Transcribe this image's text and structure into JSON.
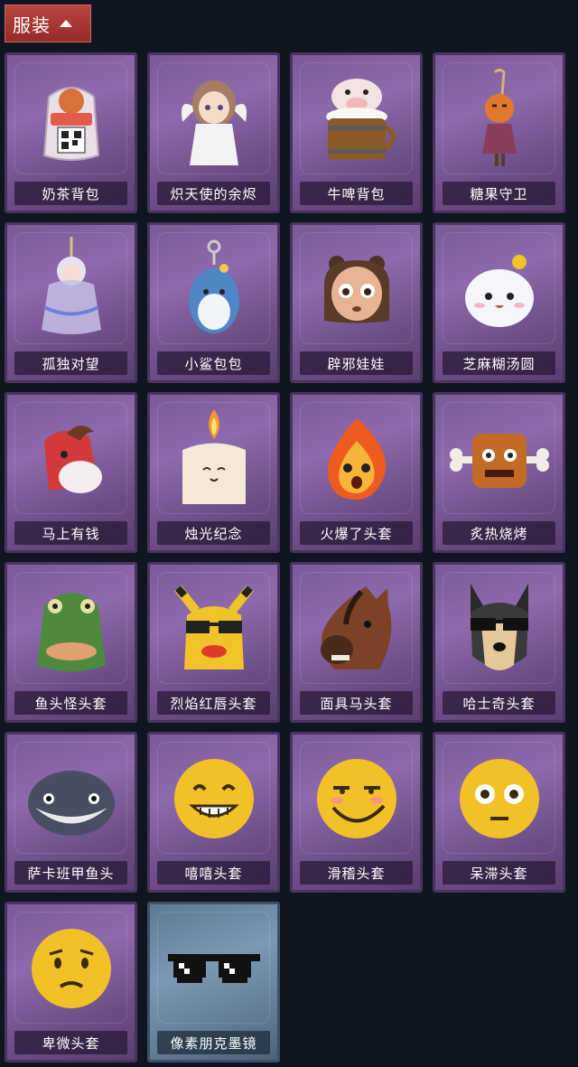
{
  "header": {
    "title": "服装"
  },
  "items": [
    {
      "label": "奶茶背包",
      "icon": "milk-tea-backpack-icon"
    },
    {
      "label": "炽天使的余烬",
      "icon": "angel-doll-icon"
    },
    {
      "label": "牛啤背包",
      "icon": "cow-beer-backpack-icon"
    },
    {
      "label": "糖果守卫",
      "icon": "candy-guard-pendant-icon"
    },
    {
      "label": "孤独对望",
      "icon": "lonely-gaze-pendant-icon"
    },
    {
      "label": "小鲨包包",
      "icon": "shark-bag-icon"
    },
    {
      "label": "辟邪娃娃",
      "icon": "talisman-doll-icon"
    },
    {
      "label": "芝麻糊汤圆",
      "icon": "rice-ball-icon"
    },
    {
      "label": "马上有钱",
      "icon": "red-horse-head-icon"
    },
    {
      "label": "烛光纪念",
      "icon": "candle-icon"
    },
    {
      "label": "火爆了头套",
      "icon": "fire-head-icon"
    },
    {
      "label": "炙热烧烤",
      "icon": "bbq-meat-icon"
    },
    {
      "label": "鱼头怪头套",
      "icon": "fish-head-icon"
    },
    {
      "label": "烈焰红唇头套",
      "icon": "yellow-mask-sunglasses-icon"
    },
    {
      "label": "面具马头套",
      "icon": "horse-mask-icon"
    },
    {
      "label": "哈士奇头套",
      "icon": "husky-sunglasses-icon"
    },
    {
      "label": "萨卡班甲鱼头",
      "icon": "armored-fish-head-icon"
    },
    {
      "label": "嘻嘻头套",
      "icon": "grin-emoji-icon"
    },
    {
      "label": "滑稽头套",
      "icon": "smirk-emoji-icon"
    },
    {
      "label": "呆滞头套",
      "icon": "dazed-emoji-icon"
    },
    {
      "label": "卑微头套",
      "icon": "humble-emoji-icon"
    },
    {
      "label": "像素朋克墨镜",
      "icon": "pixel-sunglasses-icon"
    }
  ],
  "colors": {
    "background": "#0f1521",
    "tab": "#a8363a",
    "card_purple": "#7f5c9c",
    "card_blue": "#6d8aa6"
  }
}
